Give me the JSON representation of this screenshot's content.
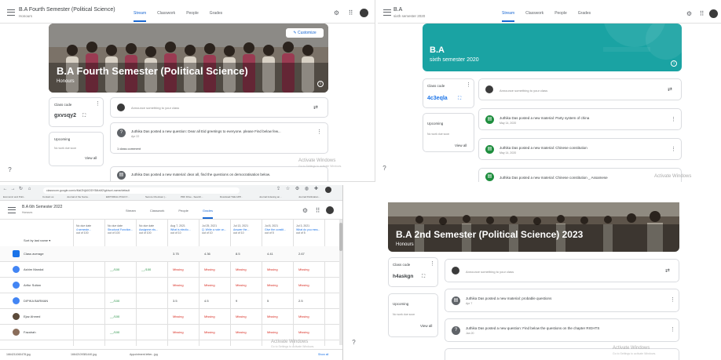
{
  "q1": {
    "class_title": "B.A Fourth Semester (Political Science)",
    "class_subtitle": "Honours",
    "tabs": [
      "Stream",
      "Classwork",
      "People",
      "Grades"
    ],
    "customize_label": "Customize",
    "banner_title": "B.A Fourth Semester (Political Science)",
    "banner_subtitle": "Honours",
    "class_code_label": "Class code",
    "class_code": "gxvsqy2",
    "upcoming_label": "Upcoming",
    "upcoming_text": "No work due soon",
    "view_all": "View all",
    "announce_placeholder": "Announce something to your class",
    "posts": [
      {
        "text": "Juthika Das posted a new question: Dear all Eid greetings to everyone. please Find below few...",
        "date": "Apr 22"
      },
      {
        "text": "Juthika Das posted a new material: dear all, find the questions on democratisation below.",
        "date": ""
      }
    ],
    "class_comment": "1 class comment",
    "watermark": "Activate Windows",
    "watermark_sub": "Go to Settings to activate Windows."
  },
  "q2": {
    "class_title": "B.A",
    "class_subtitle": "sixth semester 2020",
    "tabs": [
      "Stream",
      "Classwork",
      "People",
      "Grades"
    ],
    "banner_title": "B.A",
    "banner_subtitle": "sixth semester 2020",
    "class_code_label": "Class code",
    "class_code": "4c3eqla",
    "upcoming_label": "Upcoming",
    "upcoming_text": "No work due soon",
    "view_all": "View all",
    "announce_placeholder": "Announce something to your class",
    "posts": [
      {
        "text": "Juthika Das posted a new material: Party system of china",
        "date": "May 14, 2020"
      },
      {
        "text": "Juthika Das posted a new material: Chinese constitution",
        "date": "May 14, 2020"
      },
      {
        "text": "Juthika Das posted a new material: Chinese constitution _ Assamese",
        "date": ""
      }
    ],
    "watermark": "Activate Windows"
  },
  "q3": {
    "url": "classroom.google.com/c/MzI2NjA0ODY5MzM2/gb/sort-name/default",
    "bookmarks": [
      "Economic and Polit...",
      "Contact us",
      "Journal of the Socia...",
      "EDITORIAL POLICY...",
      "Secure Checkout |...",
      "PDF Drive - Search...",
      "Download THE APP...",
      "Journal Indexing an...",
      "Journal Publication..."
    ],
    "class_title": "B.A 6th Semester 2022",
    "class_subtitle": "Honours",
    "tabs": [
      "Stream",
      "Classwork",
      "People",
      "Grades"
    ],
    "sort_label": "Sort by last name",
    "columns": [
      {
        "due": "No due date",
        "title": "4 semeste...",
        "outof": "out of 100"
      },
      {
        "due": "No due date",
        "title": "Structural Function...",
        "outof": "out of 100"
      },
      {
        "due": "No due date",
        "title": "Assignme nts...",
        "outof": "out of 100"
      },
      {
        "due": "Aug 7, 2021",
        "title": "What is electio...",
        "outof": "out of 10"
      },
      {
        "due": "Jul 25, 2021",
        "title": "Q. Write a note on...",
        "outof": "out of 10"
      },
      {
        "due": "Jul 13, 2021",
        "title": "Answer the...",
        "outof": "out of 10"
      },
      {
        "due": "Jul 8, 2021",
        "title": "Give the constit...",
        "outof": "out of 5"
      },
      {
        "due": "Jul 3, 2021",
        "title": "What do you mea...",
        "outof": "out of 5"
      }
    ],
    "class_average_label": "Class average",
    "class_average": [
      "",
      "",
      "",
      "3.75",
      "4.36",
      "8.5",
      "4.41",
      "2.67"
    ],
    "students": [
      {
        "name": "Ashim Mandal",
        "cells": [
          "",
          "__/100",
          "__/100",
          "Missing",
          "Missing",
          "Missing",
          "Missing",
          "Missing"
        ]
      },
      {
        "name": "Arifur Sultan",
        "cells": [
          "",
          "",
          "",
          "Missing",
          "Missing",
          "Missing",
          "Missing",
          "Missing"
        ]
      },
      {
        "name": "DIPIKA BARMAN",
        "cells": [
          "",
          "__/100",
          "",
          "3.5",
          "4.5",
          "9",
          "5",
          "2.5"
        ]
      },
      {
        "name": "Ejaz Ahmed",
        "cells": [
          "",
          "__/100",
          "",
          "Missing",
          "Missing",
          "Missing",
          "Missing",
          "Missing"
        ]
      },
      {
        "name": "Fazalrah",
        "cells": [
          "",
          "__/100",
          "",
          "Missing",
          "Missing",
          "Missing",
          "Missing",
          "Missing"
        ]
      }
    ],
    "downloads": [
      "1664211060478.jpg",
      "16642109381440.jpg",
      "Appointment letter...jpg"
    ],
    "show_all": "Show all",
    "watermark": "Activate Windows",
    "watermark_sub": "Go to Settings to activate Windows."
  },
  "q4": {
    "banner_title": "B.A 2nd Semester (Political Science) 2023",
    "banner_subtitle": "Honours",
    "class_code_label": "Class code",
    "class_code": "h4askgn",
    "upcoming_label": "Upcoming",
    "upcoming_text": "No work due soon",
    "view_all": "View all",
    "announce_placeholder": "Announce something to your class",
    "posts": [
      {
        "text": "Juthika Das posted a new material: probable questions",
        "date": "Apr 7"
      },
      {
        "text": "Juthika Das posted a new question: Find below the questions on the chapter RIGHTS",
        "date": "Jan 20"
      }
    ],
    "watermark": "Activate Windows",
    "watermark_sub": "Go to Settings to activate Windows."
  },
  "colors": {
    "accent": "#1967d2",
    "teal_banner": "#1aa3a3",
    "missing": "#d93025"
  }
}
